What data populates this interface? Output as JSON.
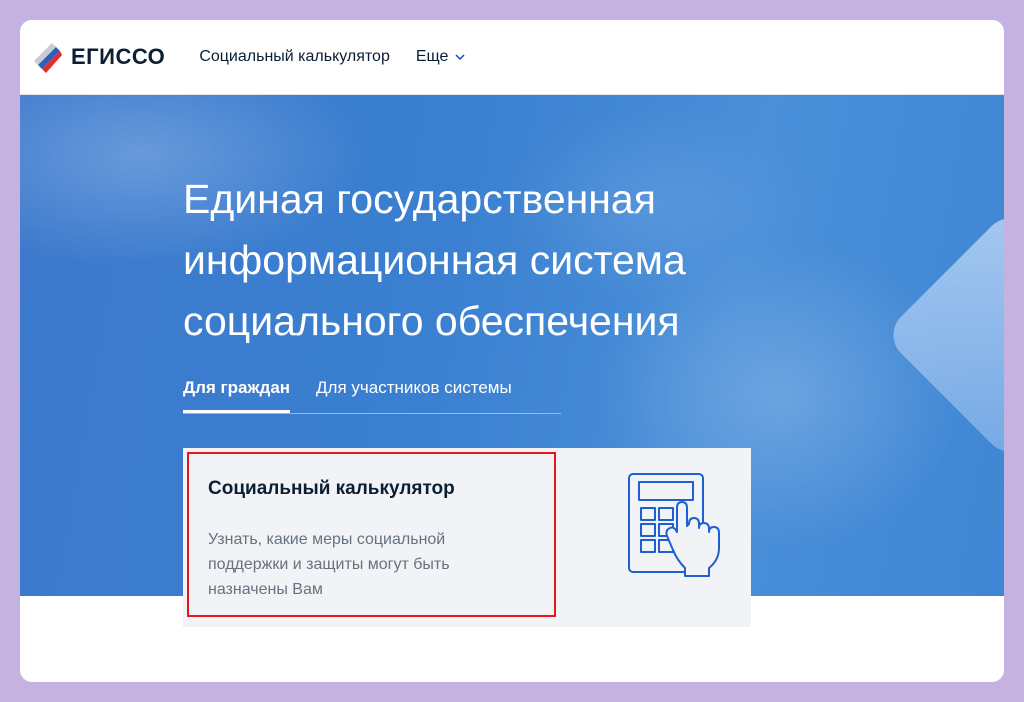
{
  "header": {
    "logo_text": "ЕГИССО",
    "nav": [
      {
        "label": "Социальный калькулятор"
      }
    ],
    "more_label": "Еще"
  },
  "hero": {
    "title_lines": [
      "Единая государственная",
      "информационная система",
      "социального обеспечения"
    ],
    "tabs": [
      {
        "label": "Для граждан",
        "active": true
      },
      {
        "label": "Для участников системы",
        "active": false
      }
    ]
  },
  "card": {
    "title": "Социальный калькулятор",
    "description_lines": [
      "Узнать, какие меры социальной",
      "поддержки и защиты могут быть",
      "назначены Вам"
    ],
    "icon": "calculator-hand-icon"
  },
  "colors": {
    "accent_blue": "#3d7dd1",
    "highlight_red": "#e8161b",
    "text_dark": "#0b1f33",
    "text_muted": "#66727f",
    "frame": "#c4b3e0"
  }
}
